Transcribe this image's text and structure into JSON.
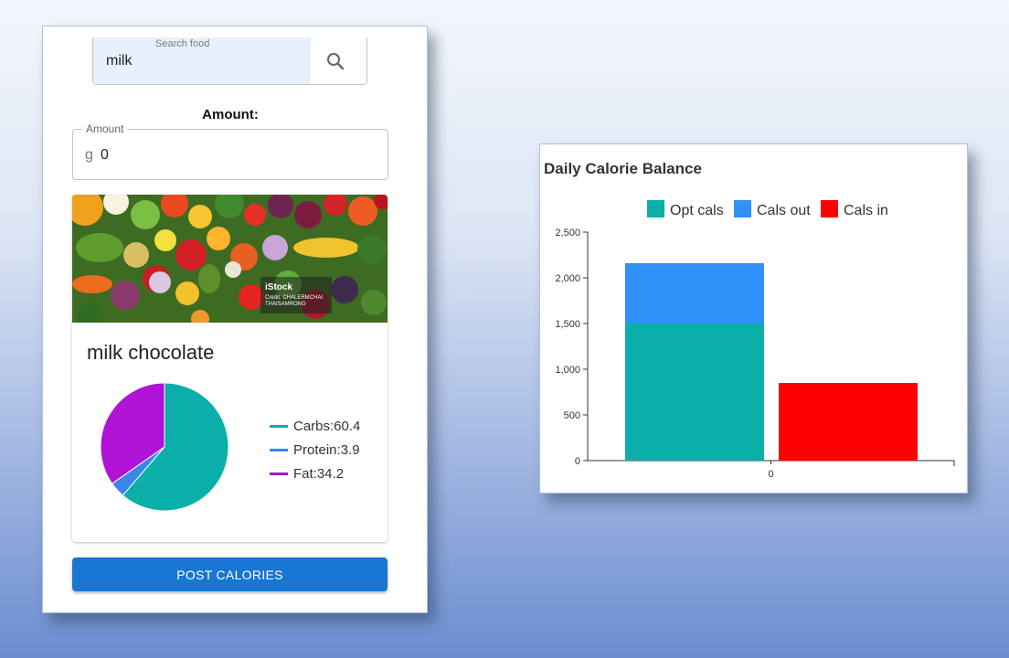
{
  "search": {
    "label": "Search food",
    "value": "milk",
    "icon": "search-icon"
  },
  "amount": {
    "title": "Amount:",
    "label": "Amount",
    "unit": "g",
    "value": "0"
  },
  "food": {
    "name": "milk chocolate",
    "image_credit": {
      "brand": "iStock",
      "line1": "Credit: CHALERMCHAI",
      "line2": "THAISAMRONG"
    },
    "nutrients": [
      {
        "label": "Carbs:60.4",
        "name": "Carbs",
        "value": 60.4,
        "color": "#0aafa9"
      },
      {
        "label": "Protein:3.9",
        "name": "Protein",
        "value": 3.9,
        "color": "#3a86e8"
      },
      {
        "label": "Fat:34.2",
        "name": "Fat",
        "value": 34.2,
        "color": "#b012d6"
      }
    ]
  },
  "post_button": {
    "label": "POST CALORIES"
  },
  "chart_data": {
    "type": "bar",
    "title": "Daily Calorie Balance",
    "stacked": true,
    "x": [
      0
    ],
    "xticks": [
      "0"
    ],
    "ylim": [
      0,
      2500
    ],
    "yticks": [
      "0",
      "500",
      "1,000",
      "1,500",
      "2,000",
      "2,500"
    ],
    "ytick_values": [
      0,
      500,
      1000,
      1500,
      2000,
      2500
    ],
    "legend_position": "top",
    "grid": false,
    "series": [
      {
        "name": "Opt cals",
        "group": "a",
        "values": [
          1500
        ],
        "color": "#0aafa9"
      },
      {
        "name": "Cals out",
        "group": "a",
        "values": [
          660
        ],
        "color": "#3191fb"
      },
      {
        "name": "Cals in",
        "group": "b",
        "values": [
          850
        ],
        "color": "#ff0000"
      }
    ]
  }
}
